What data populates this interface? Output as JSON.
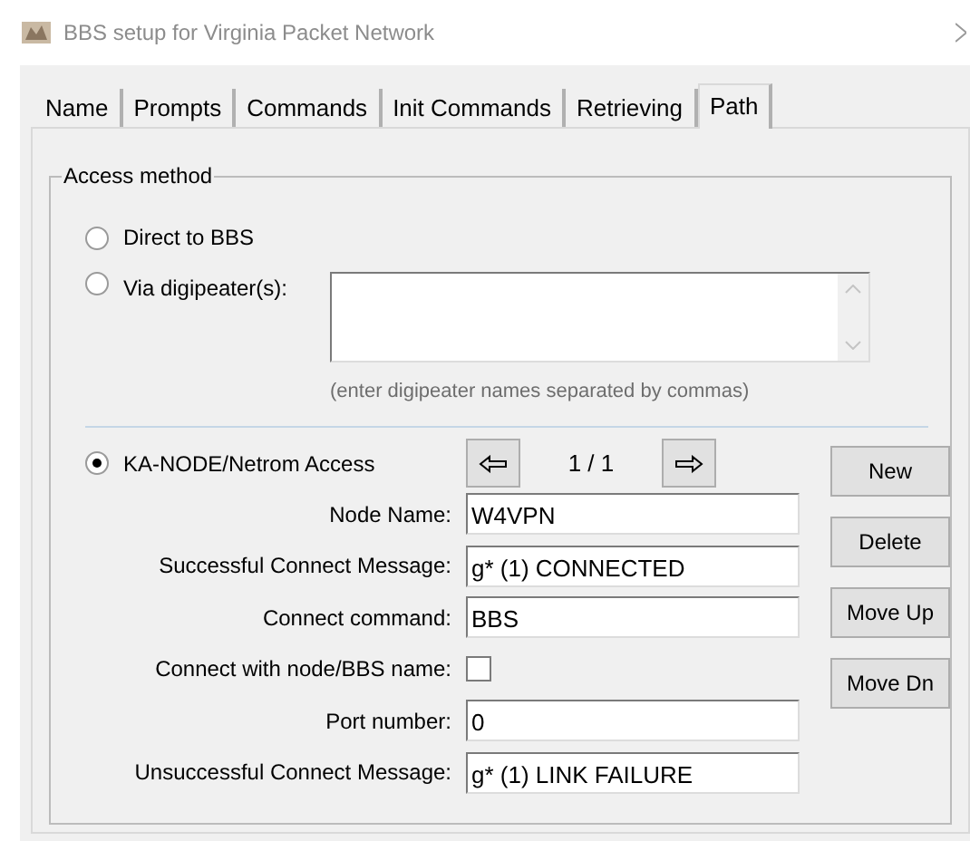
{
  "window": {
    "title": "BBS setup for Virginia Packet Network"
  },
  "tabs": [
    {
      "label": "Name",
      "selected": false
    },
    {
      "label": "Prompts",
      "selected": false
    },
    {
      "label": "Commands",
      "selected": false
    },
    {
      "label": "Init Commands",
      "selected": false
    },
    {
      "label": "Retrieving",
      "selected": false
    },
    {
      "label": "Path",
      "selected": true
    }
  ],
  "group": {
    "title": "Access method",
    "methods": [
      {
        "label": "Direct to BBS",
        "selected": false
      },
      {
        "label": "Via digipeater(s):",
        "selected": false
      },
      {
        "label": "KA-NODE/Netrom Access",
        "selected": true
      }
    ],
    "digipeater_hint": "(enter digipeater names separated by commas)",
    "counter": "1 / 1",
    "fields": [
      {
        "kind": "text",
        "label": "Node Name:",
        "value": "W4VPN"
      },
      {
        "kind": "text",
        "label": "Successful Connect Message:",
        "value": "g* (1) CONNECTED"
      },
      {
        "kind": "text",
        "label": "Connect command:",
        "value": "BBS"
      },
      {
        "kind": "checkbox",
        "label": "Connect with node/BBS name:",
        "checked": false
      },
      {
        "kind": "text",
        "label": "Port number:",
        "value": "0"
      },
      {
        "kind": "text",
        "label": "Unsuccessful Connect Message:",
        "value": "g* (1) LINK FAILURE"
      }
    ],
    "buttons": [
      "New",
      "Delete",
      "Move Up",
      "Move Dn"
    ]
  }
}
